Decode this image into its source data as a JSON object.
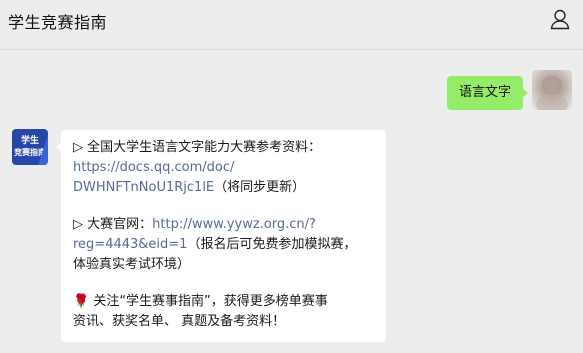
{
  "header": {
    "title": "学生竞赛指南"
  },
  "icons": {
    "profile": "person-icon"
  },
  "outgoing": {
    "text": "语言文字"
  },
  "incoming": {
    "avatar_line1": "学生",
    "avatar_line2": "竞赛指南",
    "p1_prefix": "▷ 全国大学生语言文字能力大赛参考资料：",
    "p1_link_a": "https://docs.qq.com/doc/",
    "p1_link_b": "DWHNFTnNoU1Rjc1lE",
    "p1_suffix": "（将同步更新）",
    "p2_prefix": "▷ 大赛官网：",
    "p2_link_a": "http://www.yywz.org.cn/?",
    "p2_link_b": "reg=4443&eid=1",
    "p2_suffix_a": "（报名后可免费参加模拟赛，",
    "p2_suffix_b": "体验真实考试环境）",
    "p3_icon": "🌹",
    "p3_line1": " 关注“学生赛事指南”，获得更多榜单赛事",
    "p3_line2": "资讯、获奖名单、 真题及备考资料！"
  },
  "colors": {
    "background": "#ededed",
    "outgoing_bubble": "#95ec69",
    "incoming_bubble": "#ffffff",
    "link": "#576b95",
    "bot_avatar": "#2747a8"
  }
}
